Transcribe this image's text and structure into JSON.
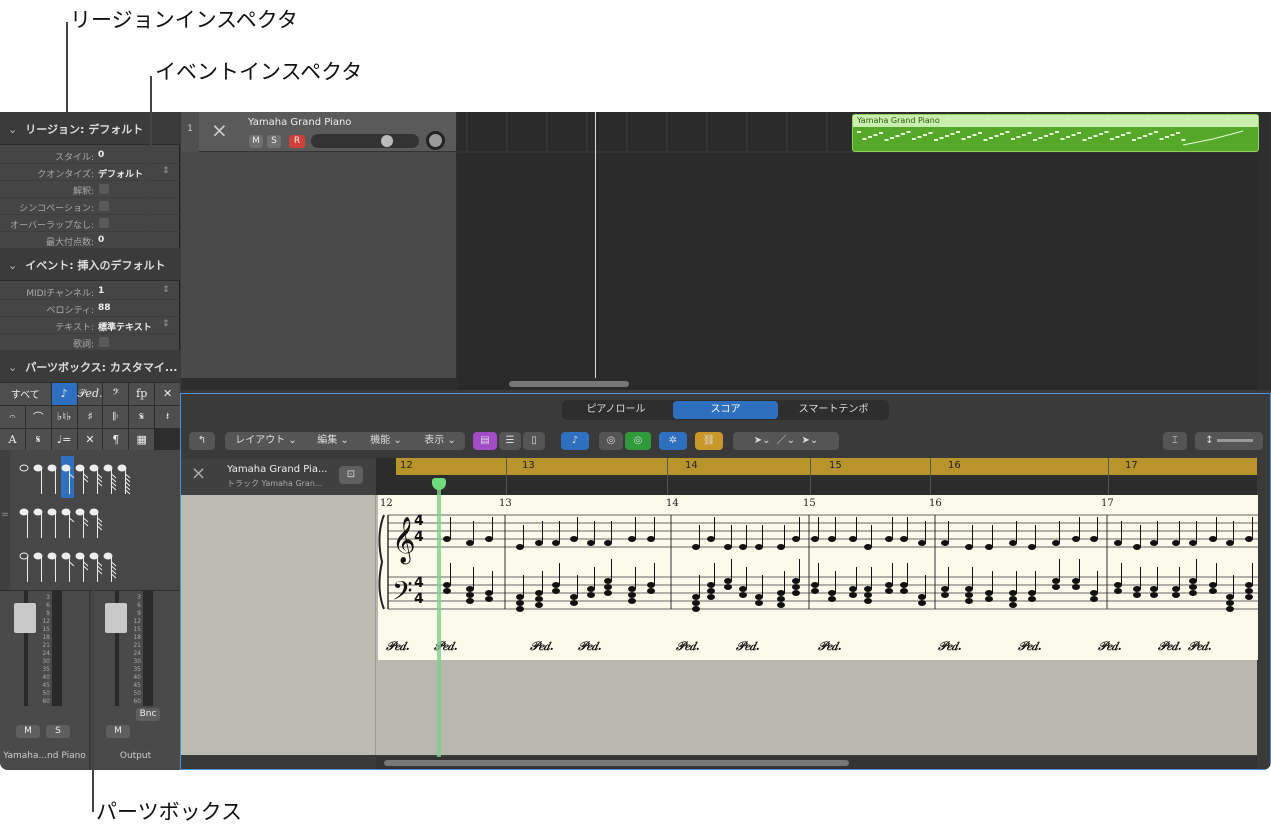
{
  "callouts": {
    "region_inspector": "リージョンインスペクタ",
    "event_inspector": "イベントインスペクタ",
    "parts_box": "パーツボックス"
  },
  "inspector": {
    "region_header": "リージョン: デフォルト",
    "region_rows": [
      {
        "label": "スタイル:",
        "value": "0"
      },
      {
        "label": "クオンタイズ:",
        "value": "デフォルト",
        "stepper": true
      },
      {
        "label": "解釈:",
        "checkbox": true
      },
      {
        "label": "シンコペーション:",
        "checkbox": true
      },
      {
        "label": "オーバーラップなし:",
        "checkbox": true
      },
      {
        "label": "最大付点数:",
        "value": "0"
      }
    ],
    "event_header": "イベント: 挿入のデフォルト",
    "event_rows": [
      {
        "label": "MIDIチャンネル:",
        "value": "1",
        "stepper": true
      },
      {
        "label": "ベロシティ:",
        "value": "88"
      },
      {
        "label": "テキスト:",
        "value": "標準テキスト",
        "stepper": true
      },
      {
        "label": "歌詞:",
        "checkbox": true
      }
    ],
    "partsbox_header": "パーツボックス: カスタマイ...",
    "parts_groups": [
      "すべて",
      "♪",
      "𝒫𝑒𝑑.",
      "𝄢",
      "fp",
      "✕",
      "𝄐",
      "⌒",
      "♭♮♭",
      "♯",
      "𝄆",
      "𝄋",
      "𝄽",
      "A",
      "𝄋",
      "♩=",
      "✕",
      "¶",
      "▦"
    ]
  },
  "mixer": {
    "strips": [
      {
        "name": "Yamaha...nd Piano",
        "buttons": [
          "M",
          "S"
        ]
      },
      {
        "name": "Output",
        "buttons": [
          "M"
        ],
        "extra": "Bnc"
      }
    ],
    "scale": [
      "3",
      "6",
      "9",
      "12",
      "15",
      "18",
      "21",
      "24",
      "30",
      "35",
      "40",
      "45",
      "50",
      "60"
    ]
  },
  "track": {
    "number": "1",
    "name": "Yamaha Grand Piano",
    "buttons": [
      "M",
      "S",
      "R"
    ],
    "region_name": "Yamaha Grand Piano"
  },
  "score": {
    "tabs": [
      "ピアノロール",
      "スコア",
      "スマートテンポ"
    ],
    "active_tab": 1,
    "menus": [
      "レイアウト",
      "編集",
      "機能",
      "表示"
    ],
    "track_name": "Yamaha Grand Pia...",
    "track_sub": "トラック Yamaha Gran...",
    "ruler": [
      "12",
      "13",
      "14",
      "15",
      "16",
      "17"
    ],
    "measures": [
      "12",
      "13",
      "14",
      "15",
      "16",
      "17"
    ],
    "pedal": "𝒫𝑒𝑑."
  },
  "colors": {
    "accent": "#2e6fc0",
    "region": "#56a82a",
    "ruler": "#b8942b",
    "record": "#d0403a"
  }
}
